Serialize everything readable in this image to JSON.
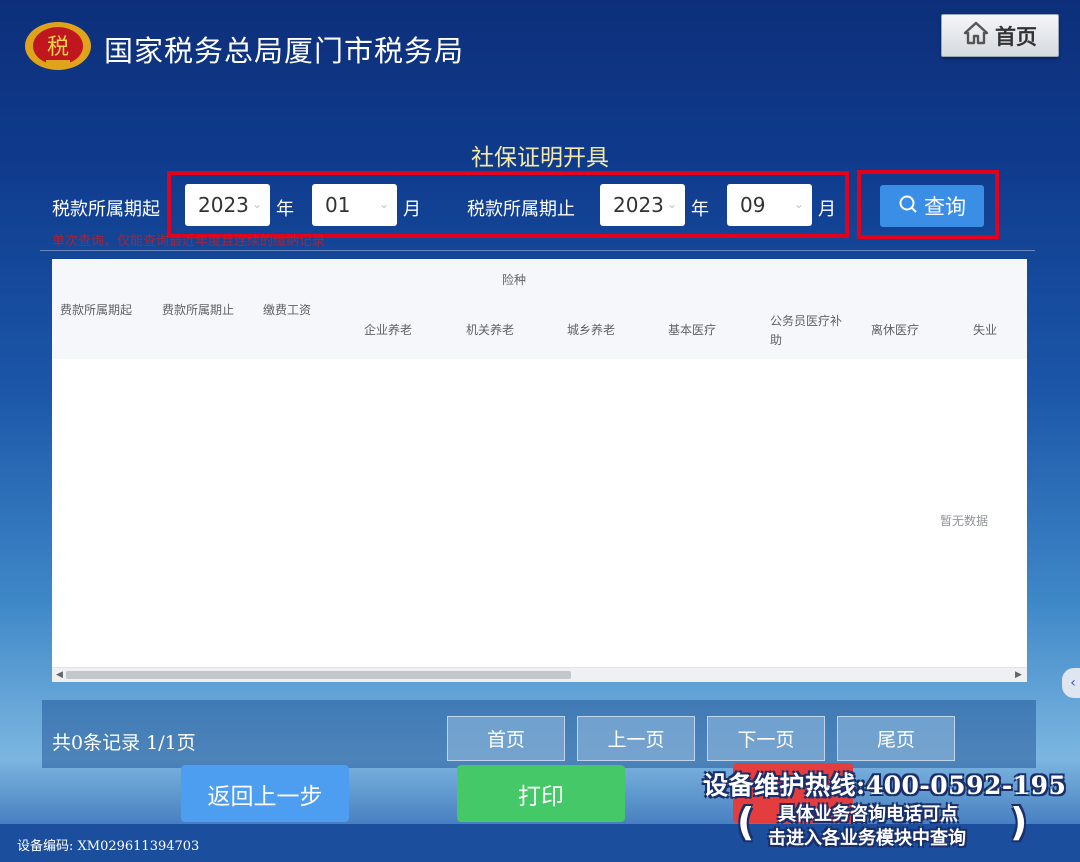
{
  "header": {
    "title": "国家税务总局厦门市税务局",
    "logo_text": "税",
    "home_label": "首页"
  },
  "page_title": "社保证明开具",
  "filter": {
    "start_label": "税款所属期起",
    "end_label": "税款所属期止",
    "start_year": "2023",
    "start_month": "01",
    "end_year": "2023",
    "end_month": "09",
    "year_unit": "年",
    "month_unit": "月",
    "query_label": "查询",
    "hint": "单次查询，仅能查询最近年度且连续的缴纳记录"
  },
  "table": {
    "group_header": "险种",
    "columns": [
      "费款所属期起",
      "费款所属期止",
      "缴费工资",
      "企业养老",
      "机关养老",
      "城乡养老",
      "基本医疗",
      "公务员医疗补助",
      "离休医疗",
      "失业"
    ],
    "empty_text": "暂无数据"
  },
  "pagination": {
    "summary": "共0条记录  1/1页",
    "first": "首页",
    "prev": "上一页",
    "next": "下一页",
    "last": "尾页"
  },
  "actions": {
    "back": "返回上一步",
    "print": "打印"
  },
  "hotline": {
    "title": "设备维护热线:400-0592-195",
    "line1": "具体业务咨询电话可点",
    "line2": "击进入各业务模块中查询"
  },
  "device_code": "设备编码:   XM029611394703",
  "colors": {
    "accent": "#3a8ee6",
    "highlight_red": "#e4001b",
    "print_green": "#45c867",
    "back_blue": "#4d9df0"
  }
}
